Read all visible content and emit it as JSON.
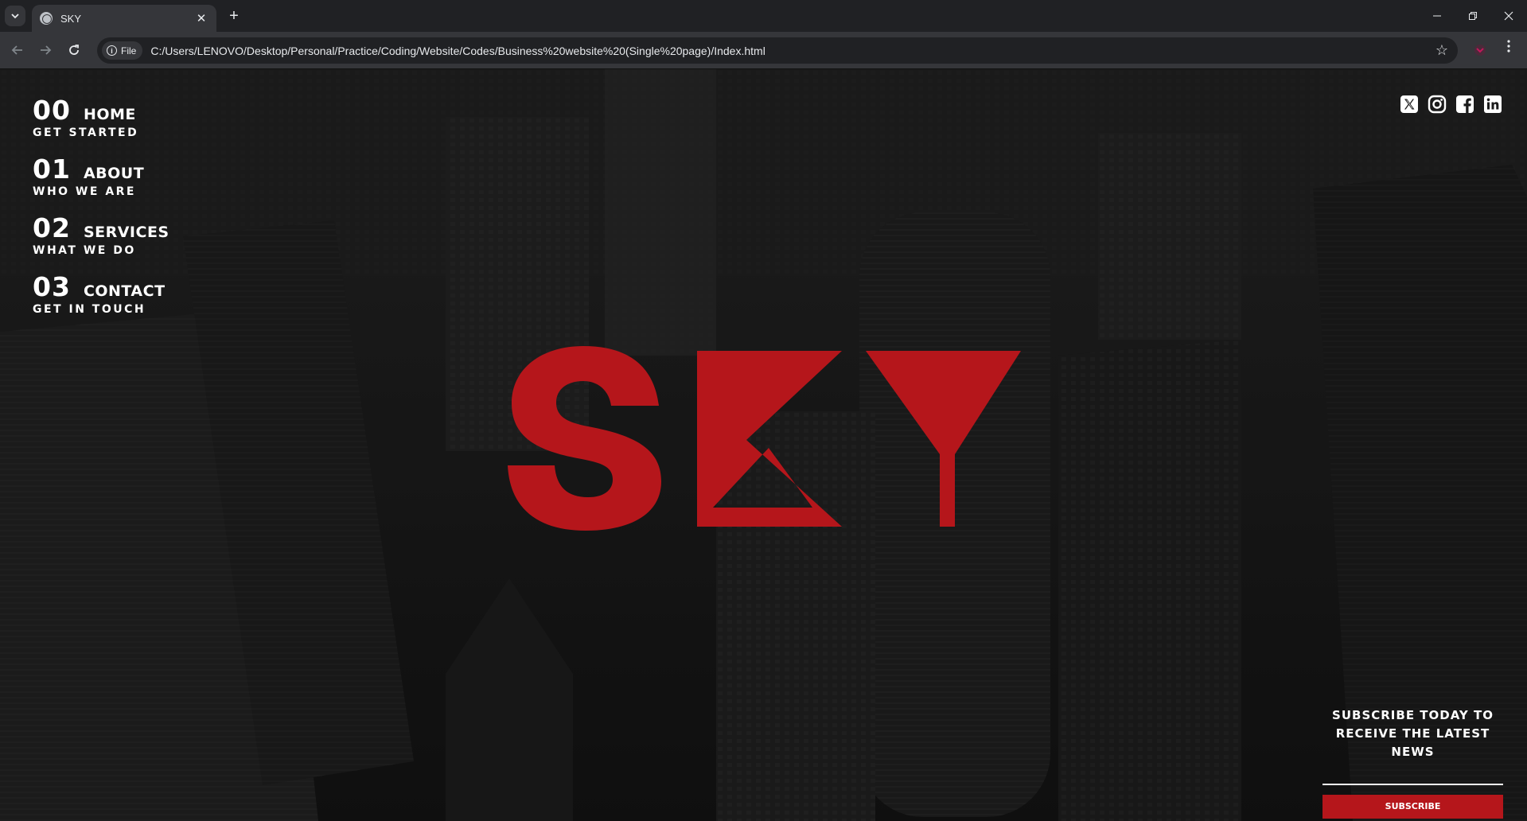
{
  "browser": {
    "tab_title": "SKY",
    "new_tab_symbol": "+",
    "tab_close_symbol": "✕",
    "chip_label": "File",
    "url": "C:/Users/LENOVO/Desktop/Personal/Practice/Coding/Website/Codes/Business%20website%20(Single%20page)/Index.html"
  },
  "nav": {
    "items": [
      {
        "num": "00",
        "label": "Home",
        "sub": "Get started"
      },
      {
        "num": "01",
        "label": "About",
        "sub": "Who we are"
      },
      {
        "num": "02",
        "label": "Services",
        "sub": "What we do"
      },
      {
        "num": "03",
        "label": "Contact",
        "sub": "Get in touch"
      }
    ]
  },
  "socials": [
    "x-icon",
    "instagram-icon",
    "facebook-icon",
    "linkedin-icon"
  ],
  "hero": {
    "logo_text": "SKY",
    "logo_color": "#b5161b"
  },
  "subscribe": {
    "line1": "Subscribe today to",
    "line2": "receive the latest news",
    "button_label": "Subscribe"
  },
  "colors": {
    "accent": "#b5161b",
    "background": "#1b1b1b",
    "text": "#ffffff"
  }
}
